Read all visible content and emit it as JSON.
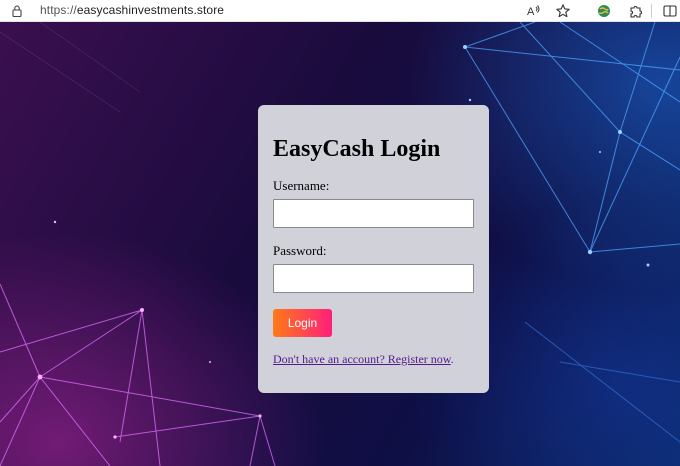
{
  "browser": {
    "url_scheme": "https://",
    "url_host": "easycashinvestments.store"
  },
  "card": {
    "title": "EasyCash Login",
    "username_label": "Username:",
    "username_value": "",
    "password_label": "Password:",
    "password_value": "",
    "login_label": "Login",
    "register_text": "Don't have an account? Register now",
    "register_suffix": "."
  },
  "colors": {
    "card_bg": "#d1d1da",
    "button_gradient_start": "#ff7a18",
    "button_gradient_end": "#ff1f7a",
    "link": "#551a8b"
  },
  "icons": [
    "lock-icon",
    "read-aloud-icon",
    "favorite-star-icon",
    "extension-globe-icon",
    "extensions-puzzle-icon",
    "split-screen-icon"
  ]
}
